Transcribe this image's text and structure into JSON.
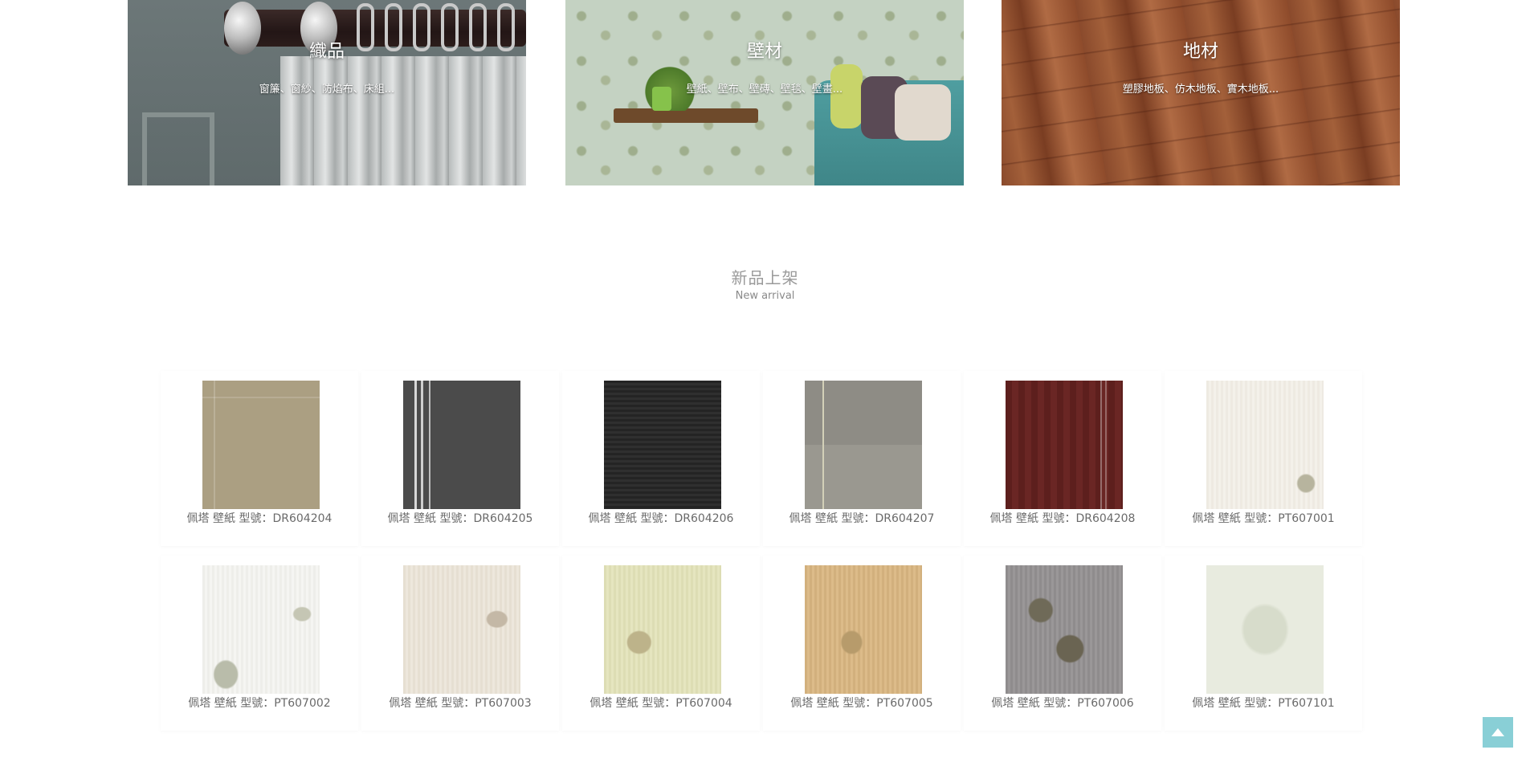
{
  "categories": [
    {
      "title": "織品",
      "subtitle": "窗簾、窗紗、防焰布、床組..."
    },
    {
      "title": "壁材",
      "subtitle": "壁紙、壁布、壁磚、壁毯、壁畫..."
    },
    {
      "title": "地材",
      "subtitle": "塑膠地板、仿木地板、實木地板..."
    }
  ],
  "section": {
    "title": "新品上架",
    "subtitle": "New arrival"
  },
  "products": [
    {
      "label": "佩塔 壁紙 型號：DR604204"
    },
    {
      "label": "佩塔 壁紙 型號：DR604205"
    },
    {
      "label": "佩塔 壁紙 型號：DR604206"
    },
    {
      "label": "佩塔 壁紙 型號：DR604207"
    },
    {
      "label": "佩塔 壁紙 型號：DR604208"
    },
    {
      "label": "佩塔 壁紙 型號：PT607001"
    },
    {
      "label": "佩塔 壁紙 型號：PT607002"
    },
    {
      "label": "佩塔 壁紙 型號：PT607003"
    },
    {
      "label": "佩塔 壁紙 型號：PT607004"
    },
    {
      "label": "佩塔 壁紙 型號：PT607005"
    },
    {
      "label": "佩塔 壁紙 型號：PT607006"
    },
    {
      "label": "佩塔 壁紙 型號：PT607101"
    }
  ],
  "back_to_top": {
    "icon": "chevron-up-icon"
  }
}
